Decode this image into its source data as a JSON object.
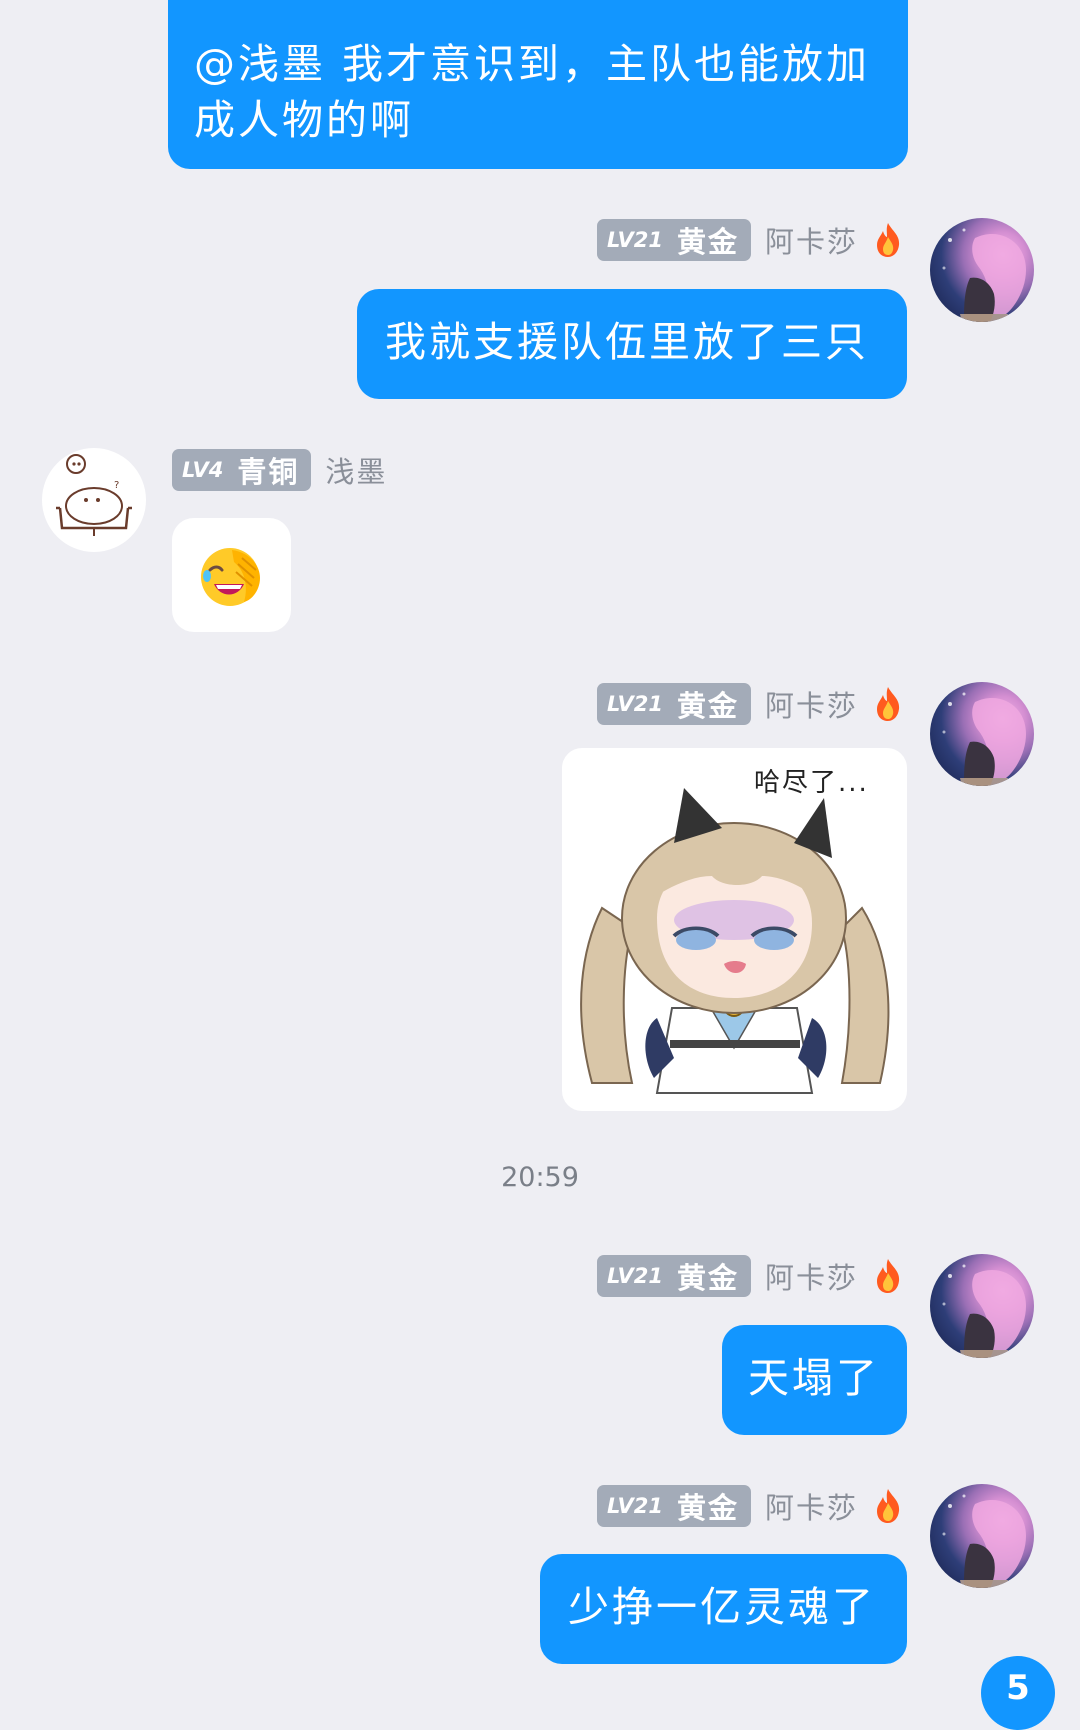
{
  "messages": {
    "m1": {
      "text": "@浅墨 我才意识到，主队也能放加成人物的啊"
    },
    "m2": {
      "level": "LV21",
      "rank": "黄金",
      "user": "阿卡莎",
      "text": "我就支援队伍里放了三只"
    },
    "m3": {
      "level": "LV4",
      "rank": "青铜",
      "user": "浅墨",
      "emoji": "facepalm-laugh"
    },
    "m4": {
      "level": "LV21",
      "rank": "黄金",
      "user": "阿卡莎",
      "sticker_caption": "哈尽了..."
    },
    "timestamp": "20:59",
    "m5": {
      "level": "LV21",
      "rank": "黄金",
      "user": "阿卡莎",
      "text": "天塌了"
    },
    "m6": {
      "level": "LV21",
      "rank": "黄金",
      "user": "阿卡莎",
      "text": "少挣一亿灵魂了"
    }
  },
  "unread_badge": "5",
  "colors": {
    "background": "#eeeef3",
    "self_bubble": "#1296ff",
    "level_badge": "#a3abb8"
  }
}
